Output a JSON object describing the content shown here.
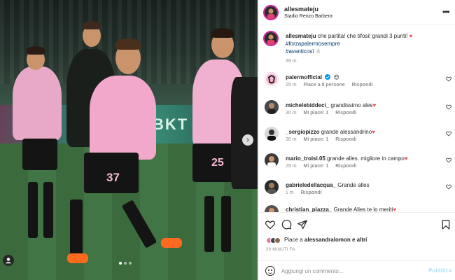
{
  "post": {
    "author": "allesmateju",
    "location": "Stadio Renzo Barbera",
    "more_icon": "more-horizontal-icon",
    "image_alt": "Palermo players celebrating on the pitch",
    "board_text": "BKT",
    "jersey_numbers": [
      "37",
      "25"
    ],
    "carousel_dots": 3,
    "carousel_active": 1
  },
  "caption": {
    "username": "allesmateju",
    "text": "che partita! che tifosi! grandi 3 punti!",
    "hashtag1": "#forzapalermosempre",
    "hashtag2": "#avanticosì",
    "time": "39 m"
  },
  "comments": [
    {
      "username": "palermofficial",
      "text": "",
      "time": "29 m",
      "likes": "Piace a 8 persone",
      "reply": "Rispondi"
    },
    {
      "username": "michelebiddeci_",
      "text": "grandissimo ales",
      "time": "30 m",
      "likes": "Mi piace: 1",
      "reply": "Rispondi"
    },
    {
      "username": "_sergiopizzo",
      "text": "grande alessandrino",
      "time": "30 m",
      "likes": "Mi piace: 1",
      "reply": "Rispondi"
    },
    {
      "username": "mario_troisi.05",
      "text": "grande alles. migliore in campo",
      "time": "29 m",
      "likes": "Mi piace: 1",
      "reply": "Rispondi"
    },
    {
      "username": "gabrieledellacqua_",
      "text": "Grande alles",
      "time": "1 m",
      "likes": "",
      "reply": "Rispondi"
    },
    {
      "username": "christian_piazza_",
      "text": "Grande Alles te lo meriti",
      "time": "",
      "likes": "",
      "reply": ""
    }
  ],
  "actions": {
    "like_icon": "heart-icon",
    "comment_icon": "comment-icon",
    "share_icon": "share-icon",
    "save_icon": "bookmark-icon",
    "liked_prefix": "Piace a",
    "liked_by": "alessandralomon",
    "liked_suffix": "e altri",
    "timestamp": "39 MINUTI FA"
  },
  "comment_box": {
    "placeholder": "Aggiungi un commento...",
    "publish_label": "Pubblica"
  },
  "colors": {
    "accent_pink": "#f3b8d0",
    "link_blue": "#00376b",
    "publish_blue": "#b2dffc",
    "verified_blue": "#0095f6",
    "heart_red": "#ed4956"
  }
}
